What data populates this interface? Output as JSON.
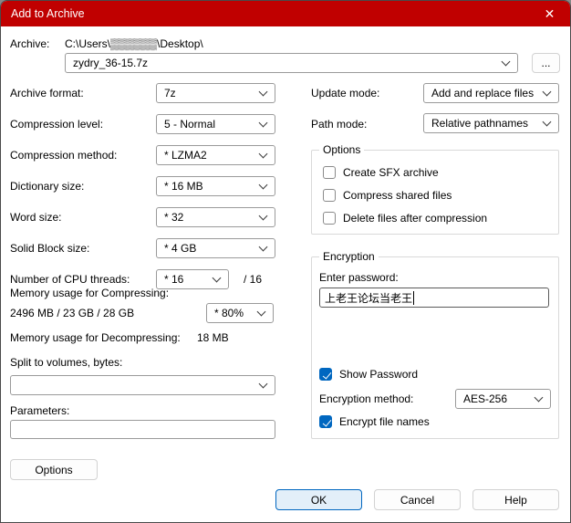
{
  "window": {
    "title": "Add to Archive",
    "close_glyph": "✕"
  },
  "archive": {
    "label": "Archive:",
    "path": "C:\\Users\\▒▒▒▒▒▒\\Desktop\\",
    "name": "zydry_36-15.7z",
    "browse": "..."
  },
  "left": {
    "archive_format": {
      "label": "Archive format:",
      "value": "7z"
    },
    "compression_level": {
      "label": "Compression level:",
      "value": "5 - Normal"
    },
    "compression_method": {
      "label": "Compression method:",
      "value": "* LZMA2"
    },
    "dictionary_size": {
      "label": "Dictionary size:",
      "value": "* 16 MB"
    },
    "word_size": {
      "label": "Word size:",
      "value": "* 32"
    },
    "solid_block_size": {
      "label": "Solid Block size:",
      "value": "* 4 GB"
    },
    "cpu_threads": {
      "label": "Number of CPU threads:",
      "value": "* 16",
      "suffix": "/ 16"
    },
    "memory_compress": {
      "label": "Memory usage for Compressing:",
      "detail": "2496 MB / 23 GB / 28 GB",
      "value": "* 80%"
    },
    "memory_decompress": {
      "label": "Memory usage for Decompressing:",
      "value": "18 MB"
    },
    "split_volumes": {
      "label": "Split to volumes, bytes:",
      "value": ""
    },
    "parameters": {
      "label": "Parameters:",
      "value": ""
    },
    "options_button": "Options"
  },
  "right": {
    "update_mode": {
      "label": "Update mode:",
      "value": "Add and replace files"
    },
    "path_mode": {
      "label": "Path mode:",
      "value": "Relative pathnames"
    },
    "options_group": {
      "title": "Options",
      "checkboxes": [
        {
          "label": "Create SFX archive",
          "checked": false
        },
        {
          "label": "Compress shared files",
          "checked": false
        },
        {
          "label": "Delete files after compression",
          "checked": false
        }
      ]
    },
    "encryption": {
      "title": "Encryption",
      "password_label": "Enter password:",
      "password_value": "上老王论坛当老王",
      "show_password": {
        "label": "Show Password",
        "checked": true
      },
      "method": {
        "label": "Encryption method:",
        "value": "AES-256"
      },
      "encrypt_names": {
        "label": "Encrypt file names",
        "checked": true
      }
    }
  },
  "footer": {
    "ok": "OK",
    "cancel": "Cancel",
    "help": "Help"
  },
  "colors": {
    "titlebar": "#c00000",
    "accent": "#0067c0"
  }
}
